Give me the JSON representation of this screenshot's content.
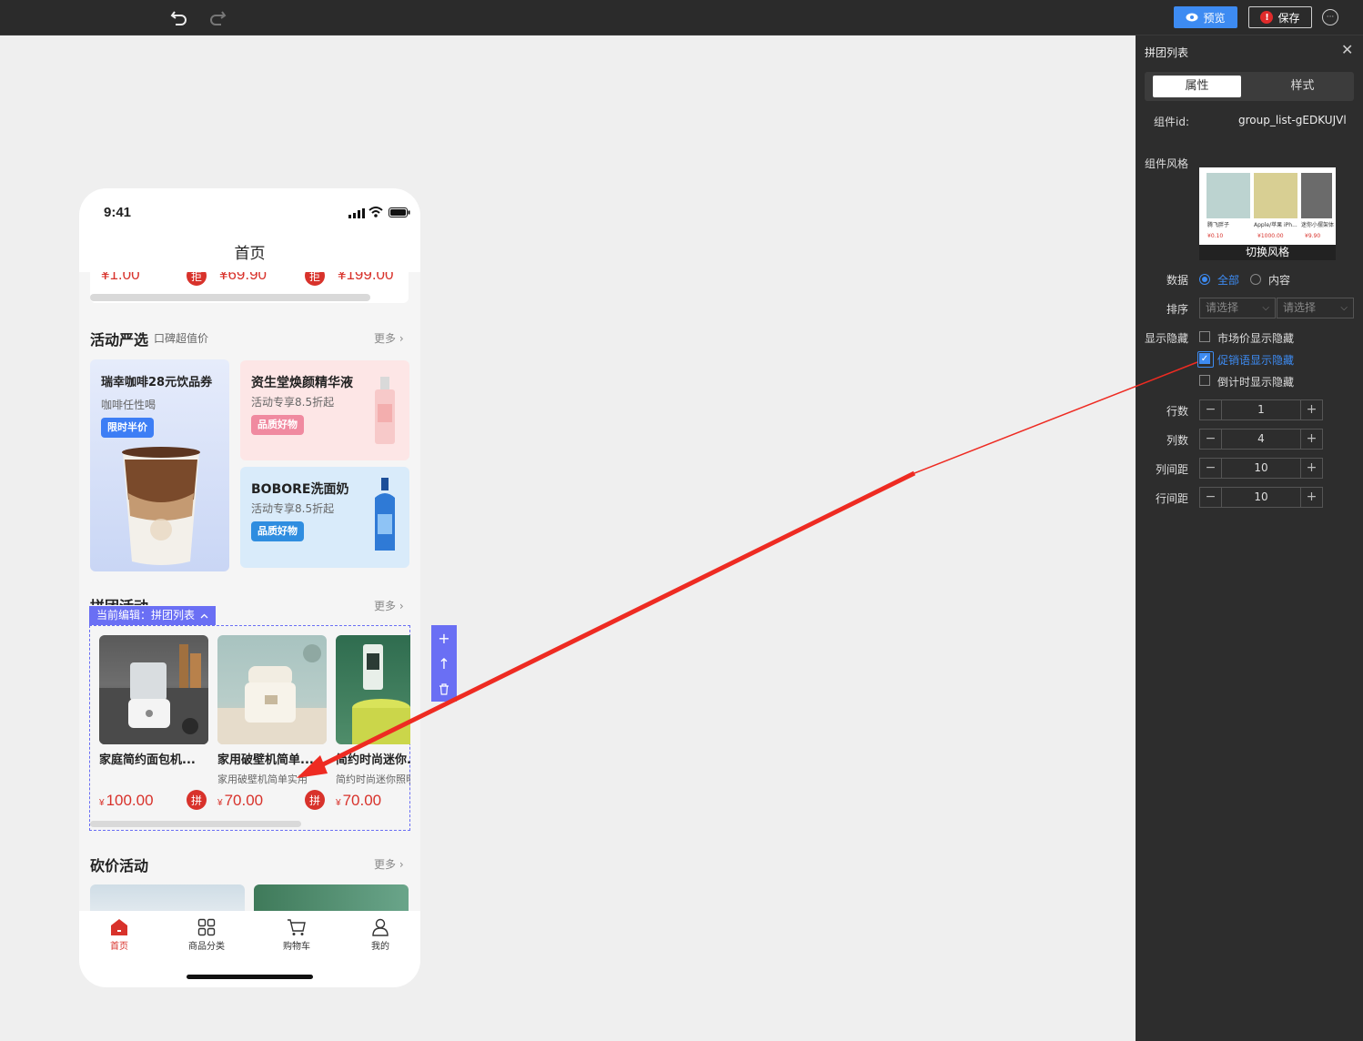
{
  "toolbar": {
    "preview_label": "预览",
    "save_label": "保存",
    "save_warning": "!",
    "more_label": "···"
  },
  "phone": {
    "time": "9:41",
    "nav_title": "首页",
    "top_strip": {
      "prices": [
        "¥1.00",
        "¥69.90",
        "¥199.00"
      ],
      "pin_label": "拒"
    },
    "activity": {
      "title": "活动严选",
      "subtitle": "口碑超值价",
      "more": "更多 ›",
      "cards": [
        {
          "title": "瑞幸咖啡28元饮品券",
          "sub": "咖啡任性喝",
          "badge": "限时半价",
          "badge_color": "#3d7ef5"
        },
        {
          "title": "资生堂焕颜精华液",
          "sub": "活动专享8.5折起",
          "badge": "品质好物",
          "badge_color": "#f08aa0"
        },
        {
          "title": "BOBORE洗面奶",
          "sub": "活动专享8.5折起",
          "badge": "品质好物",
          "badge_color": "#2f8de0"
        }
      ]
    },
    "group": {
      "title": "拼团活动",
      "more": "更多 ›",
      "edit_tag": "当前编辑：拼团列表",
      "pin_label": "拼",
      "yen": "¥",
      "items": [
        {
          "name": "家庭简约面包机...",
          "sub": "",
          "price": "100.00"
        },
        {
          "name": "家用破壁机简单...",
          "sub": "家用破壁机简单实用",
          "price": "70.00"
        },
        {
          "name": "简约时尚迷你...",
          "sub": "简约时尚迷你照明",
          "price": "70.00"
        }
      ]
    },
    "bargain": {
      "title": "砍价活动",
      "more": "更多 ›"
    },
    "tabs": [
      {
        "label": "首页",
        "icon": "home-icon",
        "active": true
      },
      {
        "label": "商品分类",
        "icon": "grid-icon",
        "active": false
      },
      {
        "label": "购物车",
        "icon": "cart-icon",
        "active": false
      },
      {
        "label": "我的",
        "icon": "user-icon",
        "active": false
      }
    ],
    "side_tools": [
      "+",
      "↑",
      "🗑"
    ]
  },
  "panel": {
    "title": "拼团列表",
    "tab_props": "属性",
    "tab_style": "样式",
    "id_label": "组件id:",
    "id_value": "group_list-gEDKUJVl",
    "style_label": "组件风格",
    "style_switch": "切换风格",
    "thumb_items": [
      {
        "name": "腾飞胖子",
        "price": "¥0.10"
      },
      {
        "name": "Apple/苹果 iPh...",
        "price": "¥1000.00"
      },
      {
        "name": "迷你小摆架体",
        "price": "¥9.90"
      }
    ],
    "data_label": "数据",
    "data_options": [
      "全部",
      "内容"
    ],
    "sort_label": "排序",
    "sort_placeholder": "请选择",
    "visibility_label": "显示隐藏",
    "checkboxes": [
      {
        "label": "市场价显示隐藏",
        "checked": false
      },
      {
        "label": "促销语显示隐藏",
        "checked": true
      },
      {
        "label": "倒计时显示隐藏",
        "checked": false
      }
    ],
    "steppers": [
      {
        "label": "行数",
        "value": "1"
      },
      {
        "label": "列数",
        "value": "4"
      },
      {
        "label": "列间距",
        "value": "10"
      },
      {
        "label": "行间距",
        "value": "10"
      }
    ]
  },
  "colors": {
    "accent": "#3d8bf2",
    "price_red": "#d8322b",
    "edit_purple": "#6a6ff4",
    "annotation_arrow": "#ee2b22"
  }
}
